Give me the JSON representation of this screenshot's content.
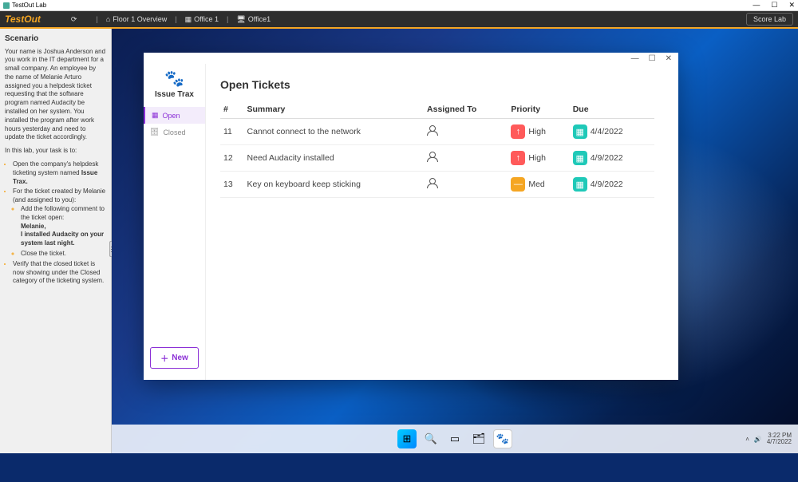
{
  "outerTitle": "TestOut Lab",
  "brand": "TestOut",
  "crumbs": {
    "overview": "Floor 1 Overview",
    "office": "Office 1",
    "pc": "Office1"
  },
  "scoreLab": "Score Lab",
  "scenario": {
    "title": "Scenario",
    "intro": "Your name is Joshua Anderson and you work in the IT department for a small company. An employee by the name of Melanie Arturo assigned you a helpdesk ticket requesting that the software program named Audacity be installed on her system. You installed the program after work hours yesterday and need to update the ticket accordingly.",
    "taskline": "In this lab, your task is to:",
    "b1a": "Open the company's helpdesk ticketing system named ",
    "b1b": "Issue Trax.",
    "b2": "For the ticket created by Melanie (and assigned to you):",
    "s1": "Add the following comment to the ticket open:",
    "s1a": "Melanie,",
    "s1b": "I installed Audacity on your system last night.",
    "s2": "Close the ticket.",
    "b3": "Verify that the closed ticket is now showing under the Closed category of the ticketing system."
  },
  "app": {
    "name": "Issue Trax",
    "navOpen": "Open",
    "navClosed": "Closed",
    "heading": "Open Tickets",
    "cols": {
      "num": "#",
      "summary": "Summary",
      "assigned": "Assigned To",
      "priority": "Priority",
      "due": "Due"
    },
    "rows": [
      {
        "num": "11",
        "summary": "Cannot connect to the network",
        "priority": "High",
        "priClass": "pri-h",
        "due": "4/4/2022"
      },
      {
        "num": "12",
        "summary": "Need Audacity installed",
        "priority": "High",
        "priClass": "pri-h",
        "due": "4/9/2022"
      },
      {
        "num": "13",
        "summary": "Key on keyboard keep sticking",
        "priority": "Med",
        "priClass": "pri-m",
        "due": "4/9/2022"
      }
    ],
    "newBtn": "New"
  },
  "tray": {
    "time": "3:22 PM",
    "date": "4/7/2022"
  }
}
